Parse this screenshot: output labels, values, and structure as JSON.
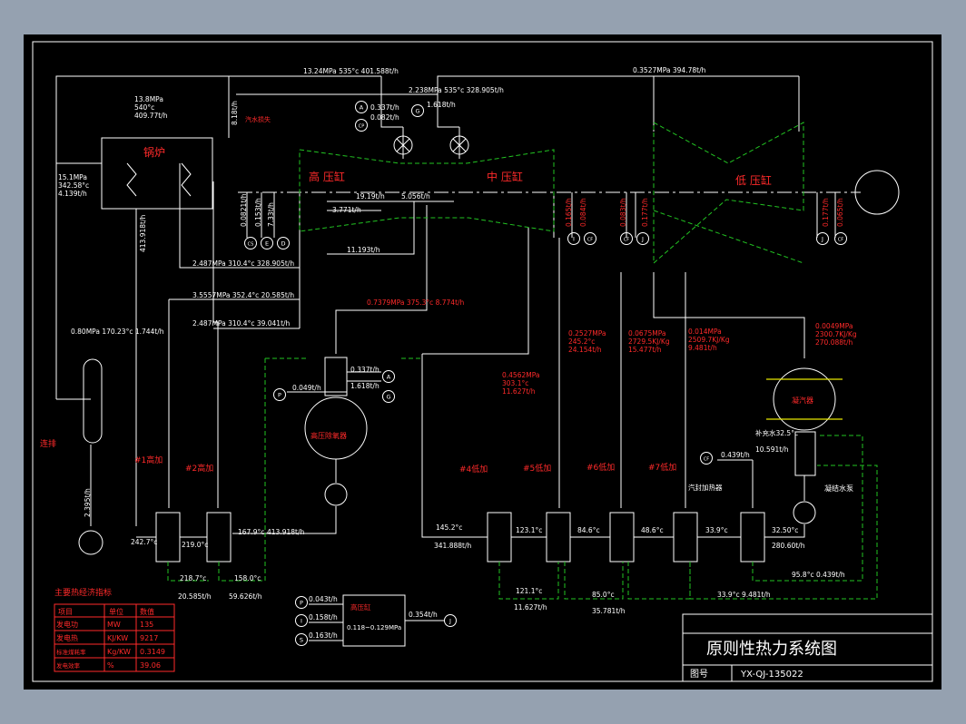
{
  "colors": {
    "background": "#95a1b0",
    "sheet": "#000000",
    "line": "#ffffff",
    "label_red": "#ff2a2a",
    "dashed_green": "#22c322",
    "yellow": "#e8e800"
  },
  "title_block": {
    "title": "原则性热力系统图",
    "drawing_no_label": "图号",
    "drawing_no": "YX-QJ-135022"
  },
  "cylinders": {
    "hp": "高 压缸",
    "ip": "中 压缸",
    "lp": "低 压缸"
  },
  "equipment": {
    "boiler": "锅炉",
    "drum": "连排",
    "deaerator": "高压除氧器",
    "condenser": "凝汽器",
    "condensate_pump": "凝结水泵",
    "gland_heater": "汽封加热器",
    "hp_box": "高压缸",
    "side_text": "汽水损失",
    "heaters": [
      "#1高加",
      "#2高加",
      "#4低加",
      "#5低加",
      "#6低加",
      "#7低加"
    ]
  },
  "labels": {
    "main_steam": "13.24MPa 535°c 401.588t/h",
    "reheat_steam": "2.238MPa 535°c 328.905t/h",
    "lp_crossover": "0.3527MPa 394.78t/h",
    "boiler_out_p": "13.8MPa",
    "boiler_out_t": "540°c",
    "boiler_out_f": "409.77t/h",
    "loss_flow": "8.18t/h",
    "feedwater_p": "15.1MPa",
    "feedwater_t": "342.58°c",
    "feedwater_f": "4.139t/h",
    "boiler_feed_flow": "413.918t/h",
    "cold_reheat": "2.487MPa 310.4°c 328.905t/h",
    "ext1": "3.5557MPa 352.4°c 20.585t/h",
    "ext2": "2.487MPa 310.4°c 39.041t/h",
    "blowdown_in": "0.80MPa 170.23°c 1.744t/h",
    "ext3_red": "0.7379MPa 375.3°c 8.774t/h",
    "hp_leak_a": "0.0821t/h",
    "hp_leak_b": "0.153t/h",
    "hp_leak_c": "7.33t/h",
    "ip_leak": "19.19t/h",
    "ip_leak2": "3.771t/h",
    "ip_leak3": "5.056t/h",
    "hp_ip_return": "11.193t/h",
    "valve_a": "0.337t/h",
    "valve_cp": "0.082t/h",
    "valve_g": "1.618t/h",
    "deaer_a": "0.337t/h",
    "deaer_p": "0.049t/h",
    "deaer_g": "1.618t/h",
    "ext4_p": "0.4562MPa",
    "ext4_t": "303.1°c",
    "ext4_f": "11.627t/h",
    "ext5_p": "0.2527MPa",
    "ext5_t": "245.2°c",
    "ext5_f": "24.154t/h",
    "ext6_p": "0.0675MPa",
    "ext6_h": "2729.5KJ/Kg",
    "ext6_f": "15.477t/h",
    "ext7_p": "0.014MPa",
    "ext7_h": "2509.7KJ/Kg",
    "ext7_f": "9.481t/h",
    "cond_p": "0.0049MPa",
    "cond_h": "2300.7KJ/Kg",
    "cond_f": "270.088t/h",
    "ip_ext_1": "0.165t/h",
    "ip_ext_2": "0.084t/h",
    "lp_ext_1": "0.083t/h",
    "lp_ext_2": "0.177t/h",
    "lp_end_1": "0.177t/h",
    "lp_end_2": "0.065t/h",
    "cond_out": "补充水32.5°c",
    "cond_out2": "10.591t/h",
    "cf_flow": "0.439t/h",
    "t_hp1": "242.7°c",
    "t_hp1b": "219.0°c",
    "t_hp2": "167.9°c",
    "f_hp2": "413.918t/h",
    "t_hp1_drain": "218.7°c",
    "t_hp2_drain": "158.0°c",
    "f_hp1_drain": "20.585t/h",
    "f_hp2_drain": "59.626t/h",
    "t_lp_in": "145.2°c",
    "f_lp": "341.888t/h",
    "t_l5": "123.1°c",
    "t_l6": "84.6°c",
    "t_l7": "48.6°c",
    "t_gl": "33.9°c",
    "t_gl_in": "32.50°c",
    "f_gl": "280.60t/h",
    "drain_l5": "121.1°c",
    "drain_l5f": "11.627t/h",
    "drain_pump_t": "85.0°c",
    "drain_l6f": "35.781t/h",
    "drain_l7": "33.9°c 9.481t/h",
    "drain_gl": "95.8°c 0.439t/h",
    "blowdown_out": "2.395t/h",
    "box_p": "0.043t/h",
    "box_i": "0.158t/h",
    "box_s": "0.163t/h",
    "box_out": "0.354t/h",
    "box_range": "0.118~0.129MPa"
  },
  "nodes": {
    "A": "A",
    "CP": "CP",
    "G": "G",
    "CS": "CS",
    "E": "E",
    "D": "D",
    "I": "I",
    "CF": "CF",
    "J": "J",
    "P": "P",
    "S": "S",
    "H": "H"
  },
  "econ_table": {
    "title": "主要热经济指标",
    "headers": [
      "项目",
      "单位",
      "数值"
    ],
    "rows": [
      [
        "发电功",
        "MW",
        "135"
      ],
      [
        "发电热",
        "KJ/KW",
        "9217"
      ],
      [
        "标准煤耗率",
        "Kg/KW",
        "0.3149"
      ],
      [
        "发电效率",
        "%",
        "39.06"
      ]
    ]
  }
}
